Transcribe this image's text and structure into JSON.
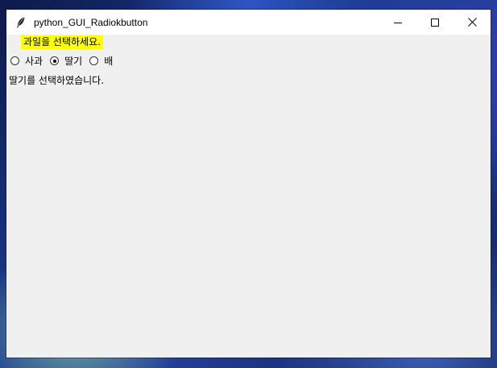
{
  "window": {
    "title": "python_GUI_Radiokbutton"
  },
  "prompt_label": "과일을 선택하세요.",
  "radios": [
    {
      "label": "사과",
      "checked": false
    },
    {
      "label": "딸기",
      "checked": true
    },
    {
      "label": "배",
      "checked": false
    }
  ],
  "result_label": "딸기를 선택하였습니다.",
  "colors": {
    "prompt_bg": "#ffff00",
    "client_bg": "#f0f0f0",
    "titlebar_bg": "#ffffff"
  },
  "icons": {
    "app": "feather-icon",
    "minimize": "minimize-icon",
    "maximize": "maximize-icon",
    "close": "close-icon"
  }
}
